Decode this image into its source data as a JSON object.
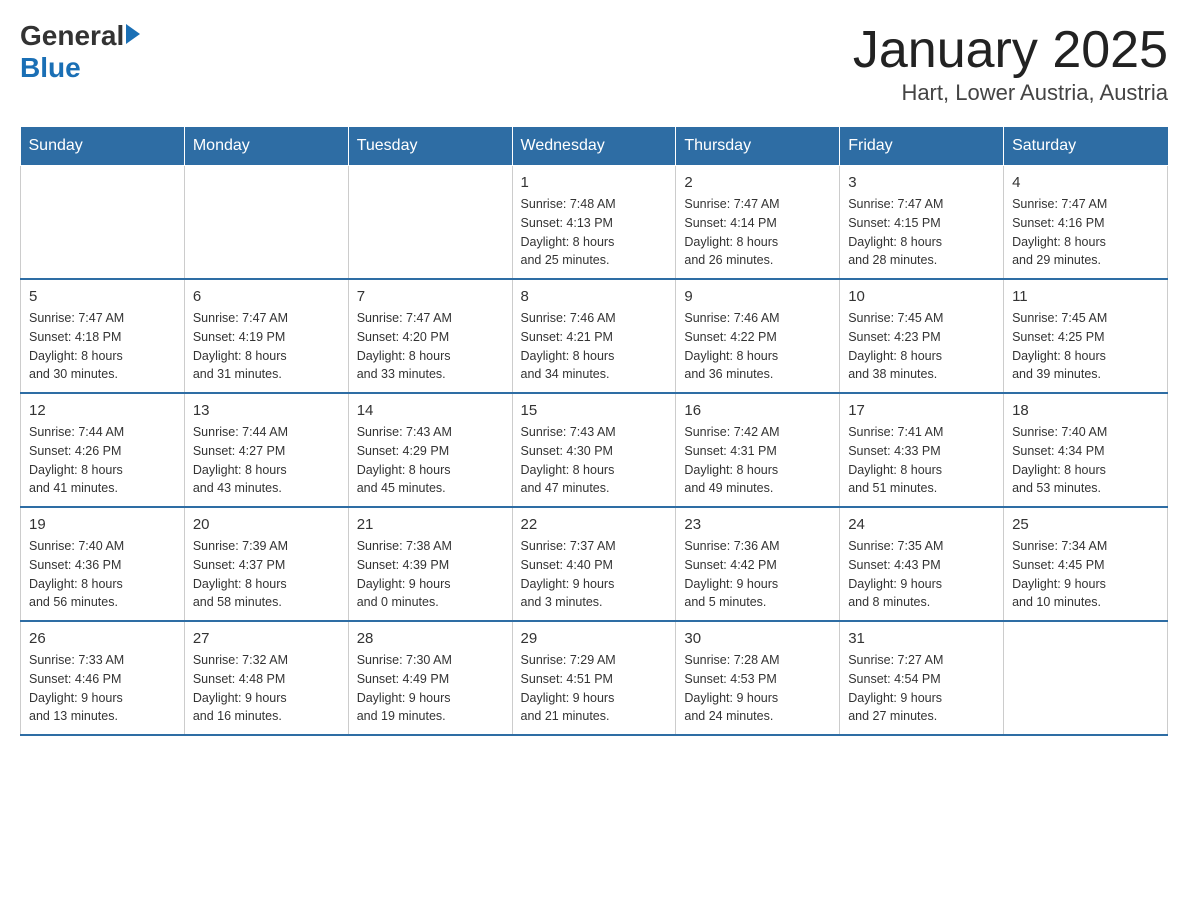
{
  "header": {
    "logo_general": "General",
    "logo_blue": "Blue",
    "month_title": "January 2025",
    "location": "Hart, Lower Austria, Austria"
  },
  "days_of_week": [
    "Sunday",
    "Monday",
    "Tuesday",
    "Wednesday",
    "Thursday",
    "Friday",
    "Saturday"
  ],
  "weeks": [
    [
      {
        "day": "",
        "info": ""
      },
      {
        "day": "",
        "info": ""
      },
      {
        "day": "",
        "info": ""
      },
      {
        "day": "1",
        "info": "Sunrise: 7:48 AM\nSunset: 4:13 PM\nDaylight: 8 hours\nand 25 minutes."
      },
      {
        "day": "2",
        "info": "Sunrise: 7:47 AM\nSunset: 4:14 PM\nDaylight: 8 hours\nand 26 minutes."
      },
      {
        "day": "3",
        "info": "Sunrise: 7:47 AM\nSunset: 4:15 PM\nDaylight: 8 hours\nand 28 minutes."
      },
      {
        "day": "4",
        "info": "Sunrise: 7:47 AM\nSunset: 4:16 PM\nDaylight: 8 hours\nand 29 minutes."
      }
    ],
    [
      {
        "day": "5",
        "info": "Sunrise: 7:47 AM\nSunset: 4:18 PM\nDaylight: 8 hours\nand 30 minutes."
      },
      {
        "day": "6",
        "info": "Sunrise: 7:47 AM\nSunset: 4:19 PM\nDaylight: 8 hours\nand 31 minutes."
      },
      {
        "day": "7",
        "info": "Sunrise: 7:47 AM\nSunset: 4:20 PM\nDaylight: 8 hours\nand 33 minutes."
      },
      {
        "day": "8",
        "info": "Sunrise: 7:46 AM\nSunset: 4:21 PM\nDaylight: 8 hours\nand 34 minutes."
      },
      {
        "day": "9",
        "info": "Sunrise: 7:46 AM\nSunset: 4:22 PM\nDaylight: 8 hours\nand 36 minutes."
      },
      {
        "day": "10",
        "info": "Sunrise: 7:45 AM\nSunset: 4:23 PM\nDaylight: 8 hours\nand 38 minutes."
      },
      {
        "day": "11",
        "info": "Sunrise: 7:45 AM\nSunset: 4:25 PM\nDaylight: 8 hours\nand 39 minutes."
      }
    ],
    [
      {
        "day": "12",
        "info": "Sunrise: 7:44 AM\nSunset: 4:26 PM\nDaylight: 8 hours\nand 41 minutes."
      },
      {
        "day": "13",
        "info": "Sunrise: 7:44 AM\nSunset: 4:27 PM\nDaylight: 8 hours\nand 43 minutes."
      },
      {
        "day": "14",
        "info": "Sunrise: 7:43 AM\nSunset: 4:29 PM\nDaylight: 8 hours\nand 45 minutes."
      },
      {
        "day": "15",
        "info": "Sunrise: 7:43 AM\nSunset: 4:30 PM\nDaylight: 8 hours\nand 47 minutes."
      },
      {
        "day": "16",
        "info": "Sunrise: 7:42 AM\nSunset: 4:31 PM\nDaylight: 8 hours\nand 49 minutes."
      },
      {
        "day": "17",
        "info": "Sunrise: 7:41 AM\nSunset: 4:33 PM\nDaylight: 8 hours\nand 51 minutes."
      },
      {
        "day": "18",
        "info": "Sunrise: 7:40 AM\nSunset: 4:34 PM\nDaylight: 8 hours\nand 53 minutes."
      }
    ],
    [
      {
        "day": "19",
        "info": "Sunrise: 7:40 AM\nSunset: 4:36 PM\nDaylight: 8 hours\nand 56 minutes."
      },
      {
        "day": "20",
        "info": "Sunrise: 7:39 AM\nSunset: 4:37 PM\nDaylight: 8 hours\nand 58 minutes."
      },
      {
        "day": "21",
        "info": "Sunrise: 7:38 AM\nSunset: 4:39 PM\nDaylight: 9 hours\nand 0 minutes."
      },
      {
        "day": "22",
        "info": "Sunrise: 7:37 AM\nSunset: 4:40 PM\nDaylight: 9 hours\nand 3 minutes."
      },
      {
        "day": "23",
        "info": "Sunrise: 7:36 AM\nSunset: 4:42 PM\nDaylight: 9 hours\nand 5 minutes."
      },
      {
        "day": "24",
        "info": "Sunrise: 7:35 AM\nSunset: 4:43 PM\nDaylight: 9 hours\nand 8 minutes."
      },
      {
        "day": "25",
        "info": "Sunrise: 7:34 AM\nSunset: 4:45 PM\nDaylight: 9 hours\nand 10 minutes."
      }
    ],
    [
      {
        "day": "26",
        "info": "Sunrise: 7:33 AM\nSunset: 4:46 PM\nDaylight: 9 hours\nand 13 minutes."
      },
      {
        "day": "27",
        "info": "Sunrise: 7:32 AM\nSunset: 4:48 PM\nDaylight: 9 hours\nand 16 minutes."
      },
      {
        "day": "28",
        "info": "Sunrise: 7:30 AM\nSunset: 4:49 PM\nDaylight: 9 hours\nand 19 minutes."
      },
      {
        "day": "29",
        "info": "Sunrise: 7:29 AM\nSunset: 4:51 PM\nDaylight: 9 hours\nand 21 minutes."
      },
      {
        "day": "30",
        "info": "Sunrise: 7:28 AM\nSunset: 4:53 PM\nDaylight: 9 hours\nand 24 minutes."
      },
      {
        "day": "31",
        "info": "Sunrise: 7:27 AM\nSunset: 4:54 PM\nDaylight: 9 hours\nand 27 minutes."
      },
      {
        "day": "",
        "info": ""
      }
    ]
  ]
}
